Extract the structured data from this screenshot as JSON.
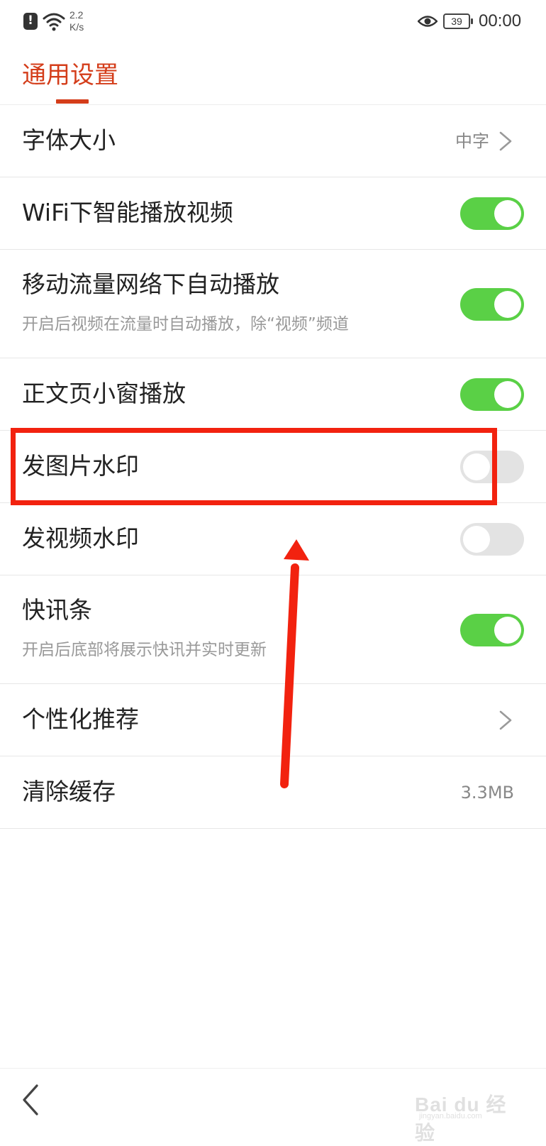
{
  "status_bar": {
    "net_speed_value": "2.2",
    "net_speed_unit": "K/s",
    "battery": "39",
    "time": "00:00"
  },
  "header": {
    "title": "通用设置"
  },
  "settings": {
    "font_size": {
      "label": "字体大小",
      "value": "中字"
    },
    "wifi_autoplay": {
      "label": "WiFi下智能播放视频",
      "enabled": true
    },
    "mobile_autoplay": {
      "label": "移动流量网络下自动播放",
      "description": "开启后视频在流量时自动播放，除“视频”频道",
      "enabled": true
    },
    "pip_playback": {
      "label": "正文页小窗播放",
      "enabled": true
    },
    "image_watermark": {
      "label": "发图片水印",
      "enabled": false
    },
    "video_watermark": {
      "label": "发视频水印",
      "enabled": false
    },
    "news_ticker": {
      "label": "快讯条",
      "description": "开启后底部将展示快讯并实时更新",
      "enabled": true
    },
    "personalized": {
      "label": "个性化推荐"
    },
    "clear_cache": {
      "label": "清除缓存",
      "value": "3.3MB"
    }
  },
  "colors": {
    "accent": "#d43d1a",
    "toggle_on": "#5ad046",
    "toggle_off": "#e3e3e3",
    "annotation": "#f2220f"
  },
  "icons": {
    "back": "back-icon",
    "chevron": "chevron-right-icon"
  },
  "watermark": {
    "brand": "Bai du 经验",
    "site": "jingyan.baidu.com"
  }
}
